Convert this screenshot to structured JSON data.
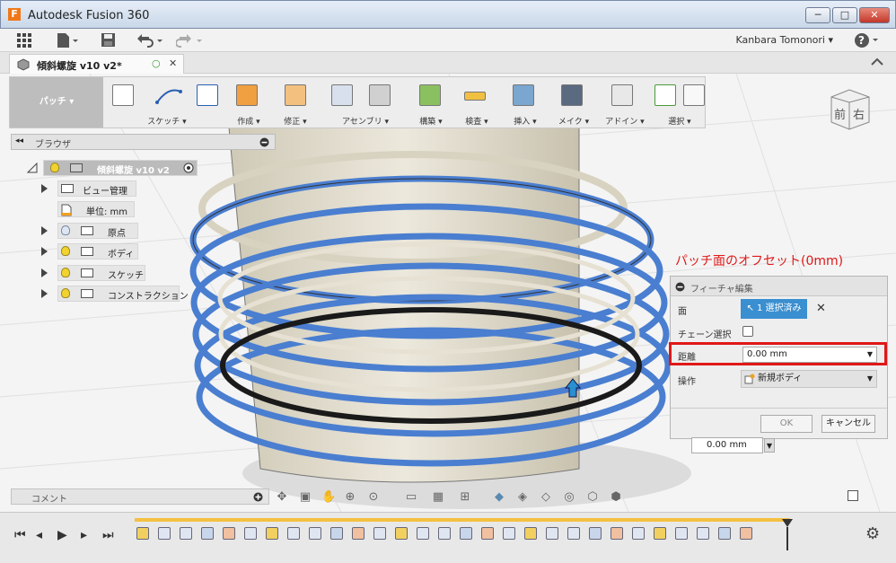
{
  "window": {
    "app_letter": "F",
    "title": "Autodesk Fusion 360",
    "minimize": "─",
    "maximize": "□",
    "close": "✕"
  },
  "topbar": {
    "user": "Kanbara Tomonori ▾",
    "help": "?"
  },
  "tab": {
    "label": "傾斜螺旋 v10 v2*",
    "status": "○",
    "close": "✕"
  },
  "ribbon": {
    "patch": "パッチ ▾",
    "groups": [
      "スケッチ ▾",
      "作成 ▾",
      "修正 ▾",
      "アセンブリ ▾",
      "構築 ▾",
      "検査 ▾",
      "挿入 ▾",
      "メイク ▾",
      "アドイン ▾",
      "選択 ▾"
    ]
  },
  "browser": {
    "title": "ブラウザ",
    "collapse": "◂◂",
    "root": "傾斜螺旋 v10 v2",
    "items": [
      "ビュー管理",
      "単位: mm",
      "原点",
      "ボディ",
      "スケッチ",
      "コンストラクション"
    ]
  },
  "annotation": "パッチ面のオフセット(0mm)",
  "feature_panel": {
    "title": "フィーチャ編集",
    "face_label": "面",
    "face_value": "1 選択済み",
    "chain_label": "チェーン選択",
    "distance_label": "距離",
    "distance_value": "0.00 mm",
    "operation_label": "操作",
    "operation_value": "新規ボディ",
    "ok": "OK",
    "cancel": "キャンセル"
  },
  "inline_value": "0.00 mm",
  "viewcube": {
    "front": "前",
    "right": "右"
  },
  "comment": {
    "label": "コメント"
  },
  "colors": {
    "accent": "#3a8fd0",
    "highlight_red": "#e01818",
    "spiral_blue": "#4a7ed0",
    "model_body": "#e8e4d6"
  }
}
